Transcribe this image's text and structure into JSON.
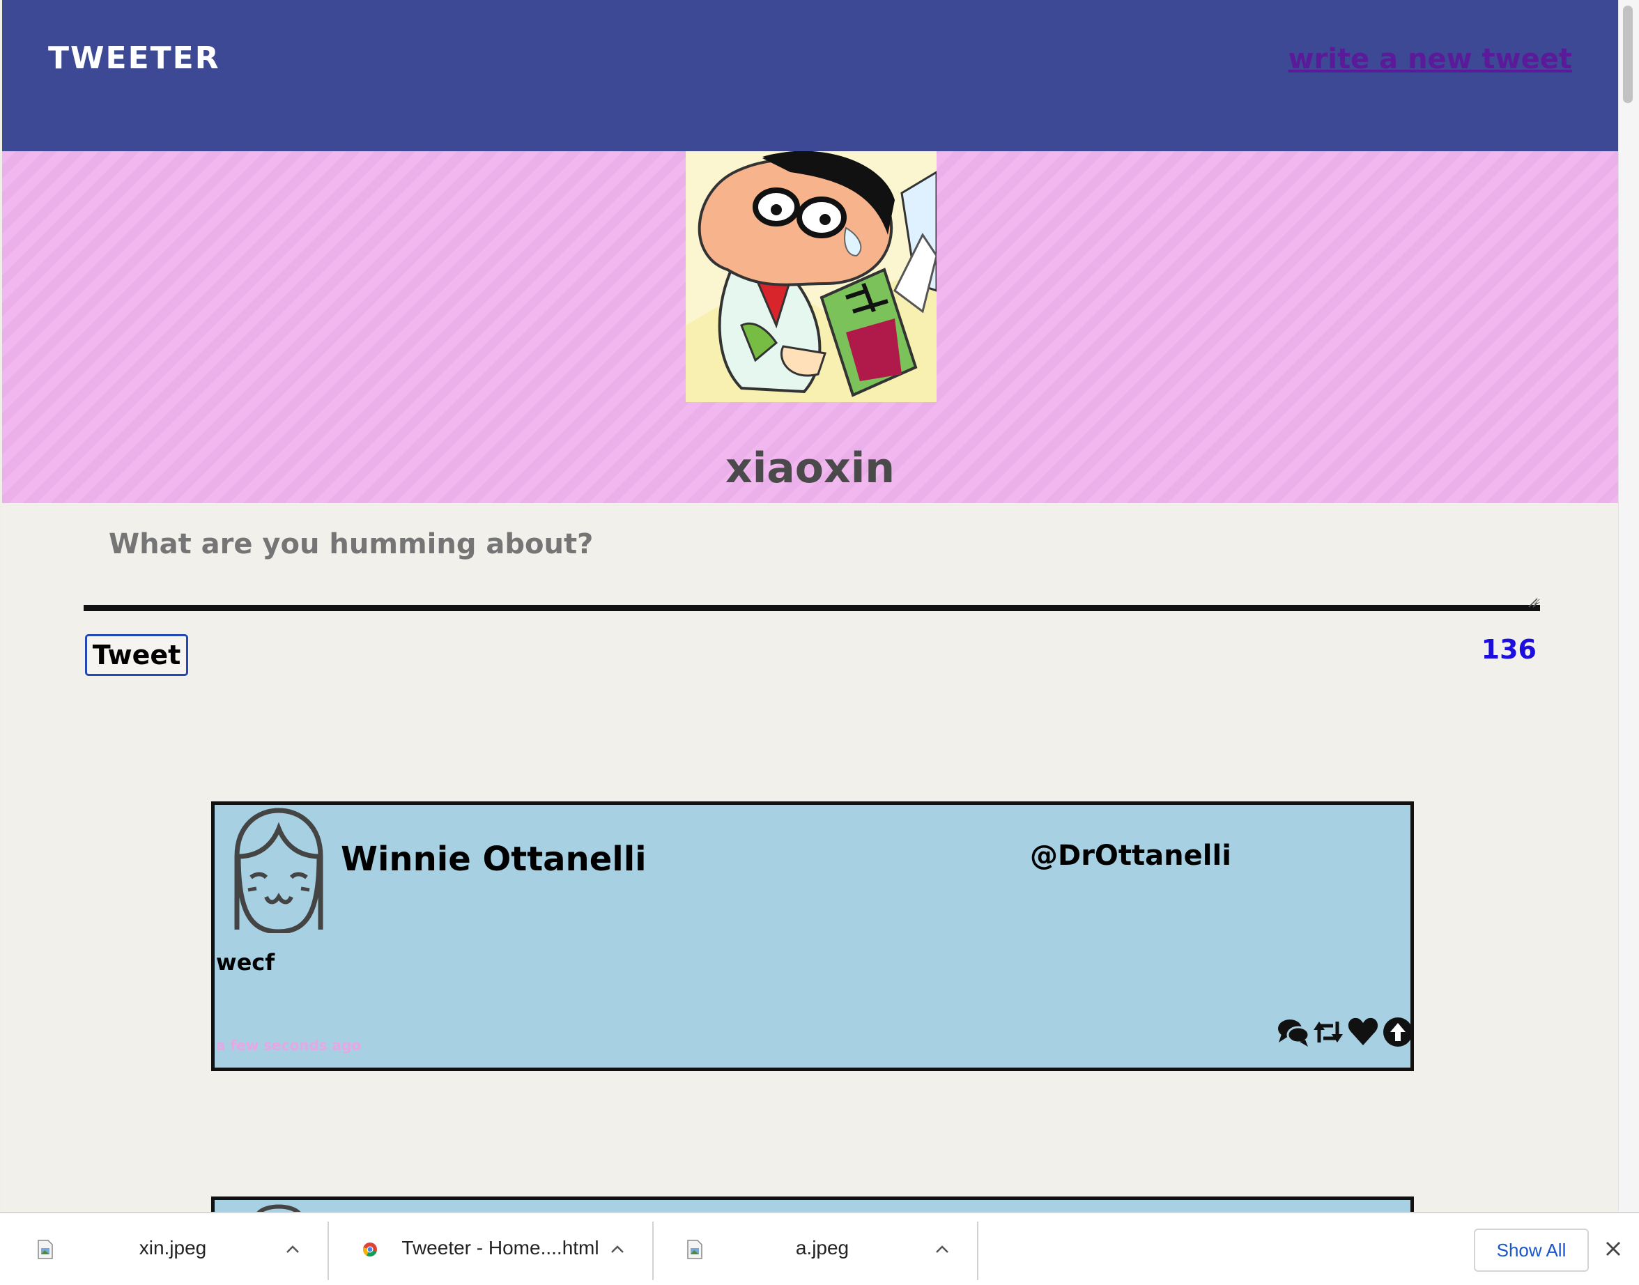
{
  "nav": {
    "brand": "TWEETER",
    "compose_link": "write a new tweet"
  },
  "profile": {
    "name": "xiaoxin"
  },
  "compose": {
    "placeholder": "What are you humming about?",
    "button_label": "Tweet",
    "counter": "136"
  },
  "tweets": [
    {
      "name": "Winnie Ottanelli",
      "handle": "@DrOttanelli",
      "text": "wecf",
      "time": "a few seconds ago",
      "actions": [
        "comment-icon",
        "retweet-icon",
        "heart-icon",
        "upvote-icon"
      ]
    }
  ],
  "downloads": {
    "items": [
      {
        "name": "xin.jpeg",
        "icon": "image-file-icon"
      },
      {
        "name": "Tweeter - Home....html",
        "icon": "chrome-icon"
      },
      {
        "name": "a.jpeg",
        "icon": "image-file-icon"
      }
    ],
    "show_all": "Show All"
  },
  "colors": {
    "nav": "#3d4994",
    "profile_bg": "#f0b4ef",
    "tweet_bg": "#a7d1e2",
    "counter": "#1d0ee0",
    "time": "#e8a6e4"
  }
}
